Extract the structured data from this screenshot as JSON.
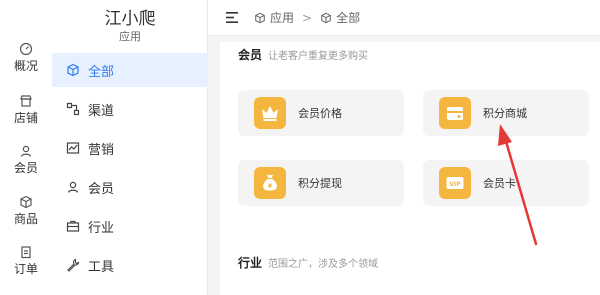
{
  "rail": {
    "items": [
      {
        "label": "概况",
        "icon": "dashboard-icon"
      },
      {
        "label": "店铺",
        "icon": "store-icon"
      },
      {
        "label": "会员",
        "icon": "user-icon"
      },
      {
        "label": "商品",
        "icon": "box-icon"
      },
      {
        "label": "订单",
        "icon": "order-icon"
      }
    ]
  },
  "sidebar": {
    "brand": "江小爬",
    "section": "应用",
    "items": [
      {
        "label": "全部",
        "icon": "cube-icon",
        "active": true
      },
      {
        "label": "渠道",
        "icon": "channel-icon"
      },
      {
        "label": "营销",
        "icon": "chart-icon"
      },
      {
        "label": "会员",
        "icon": "user-icon"
      },
      {
        "label": "行业",
        "icon": "briefcase-icon"
      },
      {
        "label": "工具",
        "icon": "wrench-icon"
      }
    ]
  },
  "header": {
    "breadcrumb": [
      "应用",
      "全部"
    ],
    "separator": ">"
  },
  "sections": [
    {
      "title": "会员",
      "description": "让老客户重复更多购买",
      "cards": [
        {
          "label": "会员价格",
          "icon": "crown-icon"
        },
        {
          "label": "积分商城",
          "icon": "points-store-icon"
        },
        {
          "label": "积分提现",
          "icon": "money-bag-icon"
        },
        {
          "label": "会员卡",
          "icon": "vip-card-icon"
        }
      ]
    },
    {
      "title": "行业",
      "description": "范围之广，涉及多个领域",
      "cards": []
    }
  ],
  "colors": {
    "accent": "#2e7cf6",
    "badge": "#f5b640",
    "annotation_arrow": "#e53935"
  }
}
